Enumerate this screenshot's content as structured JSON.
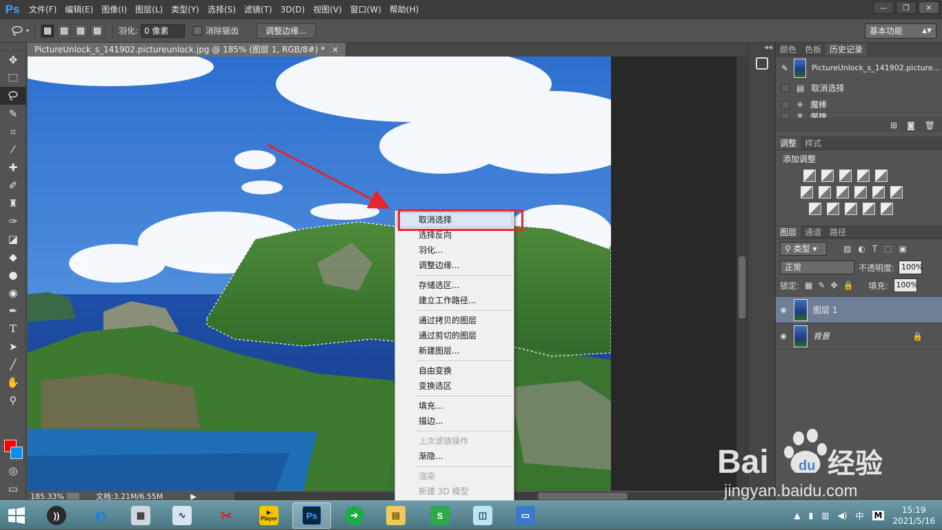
{
  "menubar": {
    "logo": "Ps",
    "items": [
      "文件(F)",
      "编辑(E)",
      "图像(I)",
      "图层(L)",
      "类型(Y)",
      "选择(S)",
      "滤镜(T)",
      "3D(D)",
      "视图(V)",
      "窗口(W)",
      "帮助(H)"
    ]
  },
  "options": {
    "feather_label": "羽化:",
    "feather_value": "0 像素",
    "antialias_label": "消除锯齿",
    "refine_edge_button": "调整边缘...",
    "workspace": "基本功能"
  },
  "document": {
    "tab_title": "PictureUnlock_s_141902.pictureunlock.jpg @ 185% (图层 1, RGB/8#) *",
    "close_glyph": "×",
    "zoom": "185.33%",
    "doc_info": "文档:3.21M/6.55M"
  },
  "history": {
    "tabs": [
      "颜色",
      "色板",
      "历史记录"
    ],
    "snapshot": "PictureUnlock_s_141902.picture...",
    "states": [
      "取消选择",
      "魔棒",
      "魔棒"
    ]
  },
  "adjustments": {
    "tabs": [
      "调整",
      "样式"
    ],
    "title": "添加调整"
  },
  "layers": {
    "tabs": [
      "图层",
      "通道",
      "路径"
    ],
    "filter_kind": "类型",
    "blend_mode": "正常",
    "opacity_label": "不透明度:",
    "opacity_value": "100%",
    "lock_label": "锁定:",
    "fill_label": "填充:",
    "fill_value": "100%",
    "rows": [
      {
        "name": "图层 1",
        "selected": true
      },
      {
        "name": "背景",
        "selected": false
      }
    ]
  },
  "context_menu": {
    "groups": [
      [
        {
          "label": "取消选择",
          "highlight": true
        },
        {
          "label": "选择反向"
        },
        {
          "label": "羽化..."
        },
        {
          "label": "调整边缘..."
        }
      ],
      [
        {
          "label": "存储选区..."
        },
        {
          "label": "建立工作路径..."
        }
      ],
      [
        {
          "label": "通过拷贝的图层"
        },
        {
          "label": "通过剪切的图层"
        },
        {
          "label": "新建图层..."
        }
      ],
      [
        {
          "label": "自由变换"
        },
        {
          "label": "变换选区"
        }
      ],
      [
        {
          "label": "填充..."
        },
        {
          "label": "描边..."
        }
      ],
      [
        {
          "label": "上次滤镜操作",
          "disabled": true
        },
        {
          "label": "渐隐..."
        }
      ],
      [
        {
          "label": "渲染",
          "disabled": true
        },
        {
          "label": "新建 3D 模型",
          "disabled": true
        }
      ]
    ]
  },
  "taskbar": {
    "time": "15:19",
    "date": "2021/5/16",
    "ime": "中",
    "ime_mode": "M",
    "player_label": "Player",
    "ps_label": "Ps"
  },
  "watermark": {
    "brand": "Bai",
    "brand_du": "du",
    "brand_cn": "经验",
    "url": "jingyan.baidu.com"
  },
  "colors": {
    "foreground": "#ff0000",
    "background": "#0a8ef2",
    "highlight_box": "#e8252a",
    "ps_blue": "#3ea3ff"
  }
}
